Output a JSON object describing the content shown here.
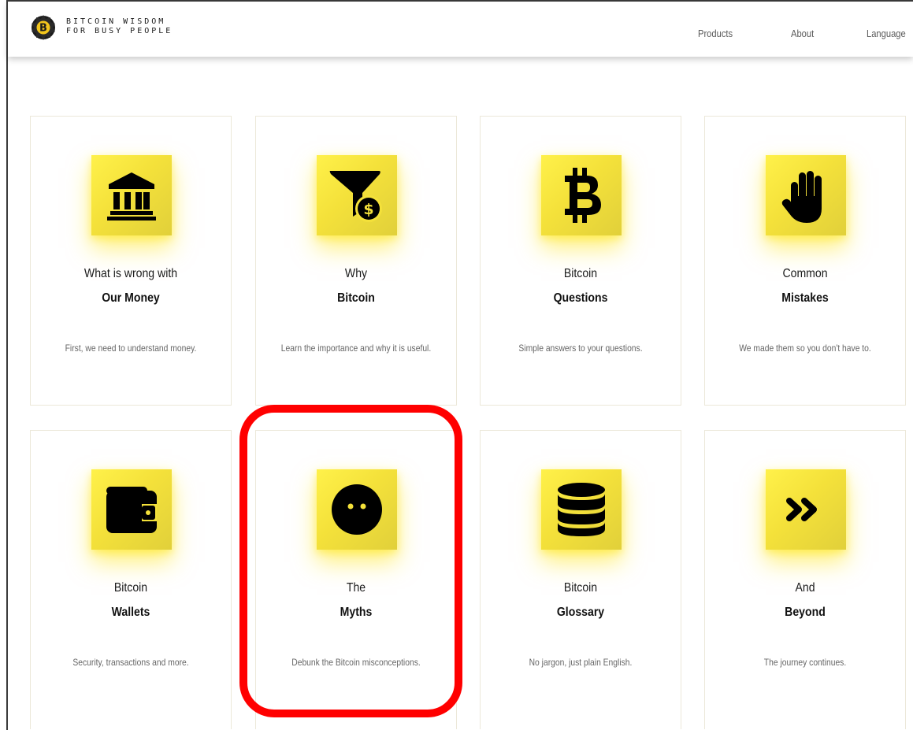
{
  "brand": {
    "line1": "BITCOIN WISDOM",
    "line2": "FOR BUSY PEOPLE",
    "badge_letter": "B"
  },
  "nav": {
    "items": [
      {
        "label": "Products"
      },
      {
        "label": "About"
      },
      {
        "label": "Language"
      }
    ]
  },
  "colors": {
    "accent_yellow": "#f4e13a",
    "highlight_red": "#ff0000",
    "icon_black": "#000000"
  },
  "cards": [
    {
      "icon": "bank-icon",
      "line1": "What is wrong with",
      "line2": "Our Money",
      "desc": "First, we need to understand money."
    },
    {
      "icon": "funnel-dollar-icon",
      "line1": "Why",
      "line2": "Bitcoin",
      "desc": "Learn the importance and why it is useful."
    },
    {
      "icon": "bitcoin-icon",
      "line1": "Bitcoin",
      "line2": "Questions",
      "desc": "Simple answers to your questions."
    },
    {
      "icon": "hand-stop-icon",
      "line1": "Common",
      "line2": "Mistakes",
      "desc": "We made them so you don't have to."
    },
    {
      "icon": "wallet-icon",
      "line1": "Bitcoin",
      "line2": "Wallets",
      "desc": "Security, transactions and more."
    },
    {
      "icon": "face-meh-icon",
      "line1": "The",
      "line2": "Myths",
      "desc": "Debunk the Bitcoin misconceptions."
    },
    {
      "icon": "database-icon",
      "line1": "Bitcoin",
      "line2": "Glossary",
      "desc": "No jargon, just plain English."
    },
    {
      "icon": "double-chevron-right-icon",
      "line1": "And",
      "line2": "Beyond",
      "desc": "The journey continues."
    }
  ]
}
